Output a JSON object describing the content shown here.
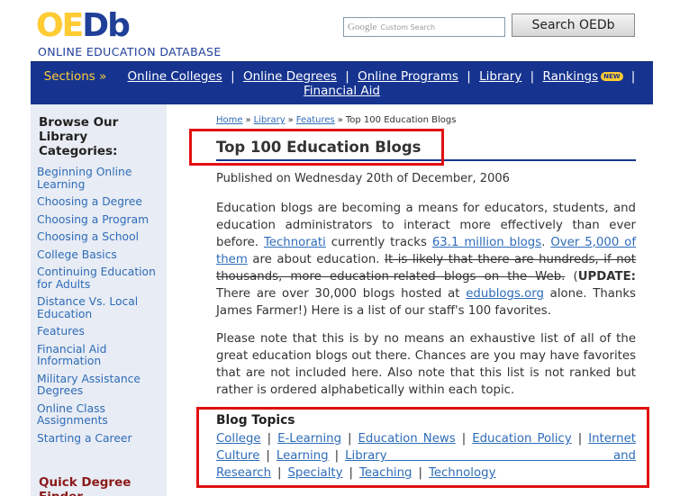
{
  "header": {
    "logo_oe": "OE",
    "logo_db": "Db",
    "tagline": "ONLINE EDUCATION DATABASE",
    "search": {
      "brand": "Google",
      "placeholder": "Custom Search",
      "button_label": "Search OEDb"
    }
  },
  "nav": {
    "sections_label": "Sections »",
    "items": [
      {
        "label": "Online Colleges"
      },
      {
        "label": "Online Degrees"
      },
      {
        "label": "Online Programs"
      },
      {
        "label": "Library"
      },
      {
        "label": "Rankings",
        "badge": "NEW"
      },
      {
        "label": "Financial Aid"
      }
    ],
    "separator": "|"
  },
  "sidebar": {
    "title": "Browse Our Library Categories:",
    "items": [
      {
        "label": "Beginning Online Learning"
      },
      {
        "label": "Choosing a Degree"
      },
      {
        "label": "Choosing a Program"
      },
      {
        "label": "Choosing a School"
      },
      {
        "label": "College Basics"
      },
      {
        "label": "Continuing Education for Adults"
      },
      {
        "label": "Distance Vs. Local Education"
      },
      {
        "label": "Features"
      },
      {
        "label": "Financial Aid Information"
      },
      {
        "label": "Military Assistance Degrees"
      },
      {
        "label": "Online Class Assignments"
      },
      {
        "label": "Starting a Career"
      }
    ],
    "quick_degree": "Quick Degree Finder"
  },
  "breadcrumb": {
    "items": [
      "Home",
      "Library",
      "Features"
    ],
    "current": "Top 100 Education Blogs",
    "separator": "»"
  },
  "article": {
    "title": "Top 100 Education Blogs",
    "published": "Published on Wednesday 20th of December, 2006",
    "p1": {
      "t1": "Education blogs are becoming a means for educators, students, and education administrators to interact more effectively than ever before. ",
      "l1": "Technorati",
      "t2": " currently tracks ",
      "l2": "63.1 million blogs",
      "t3": ". ",
      "l3": "Over 5,000 of them",
      "t4": " are about education. ",
      "strike": "It is likely that there are hundreds, if not thousands, more education-related blogs on the Web.",
      "t5": " (",
      "bold": "UPDATE:",
      "t6": " There are over 30,000 blogs hosted at ",
      "l4": "edublogs.org",
      "t7": " alone. Thanks James Farmer!) Here is a list of our staff's 100 favorites."
    },
    "p2": "Please note that this is by no means an exhaustive list of all of the great education blogs out there. Chances are you may have favorites that are not included here. Also note that this list is not ranked but rather is ordered alphabetically within each topic."
  },
  "topics": {
    "title": "Blog Topics",
    "items": [
      "College",
      "E-Learning",
      "Education News",
      "Education Policy",
      "Internet Culture",
      "Learning",
      "Library and Research",
      "Specialty",
      "Teaching",
      "Technology"
    ],
    "separator": "|"
  },
  "colors": {
    "nav_bg": "#16348f",
    "accent_yellow": "#ffcc33",
    "link": "#2e6cb8",
    "sidebar_bg": "#e8ecf4",
    "annotation_red": "#e01010"
  }
}
